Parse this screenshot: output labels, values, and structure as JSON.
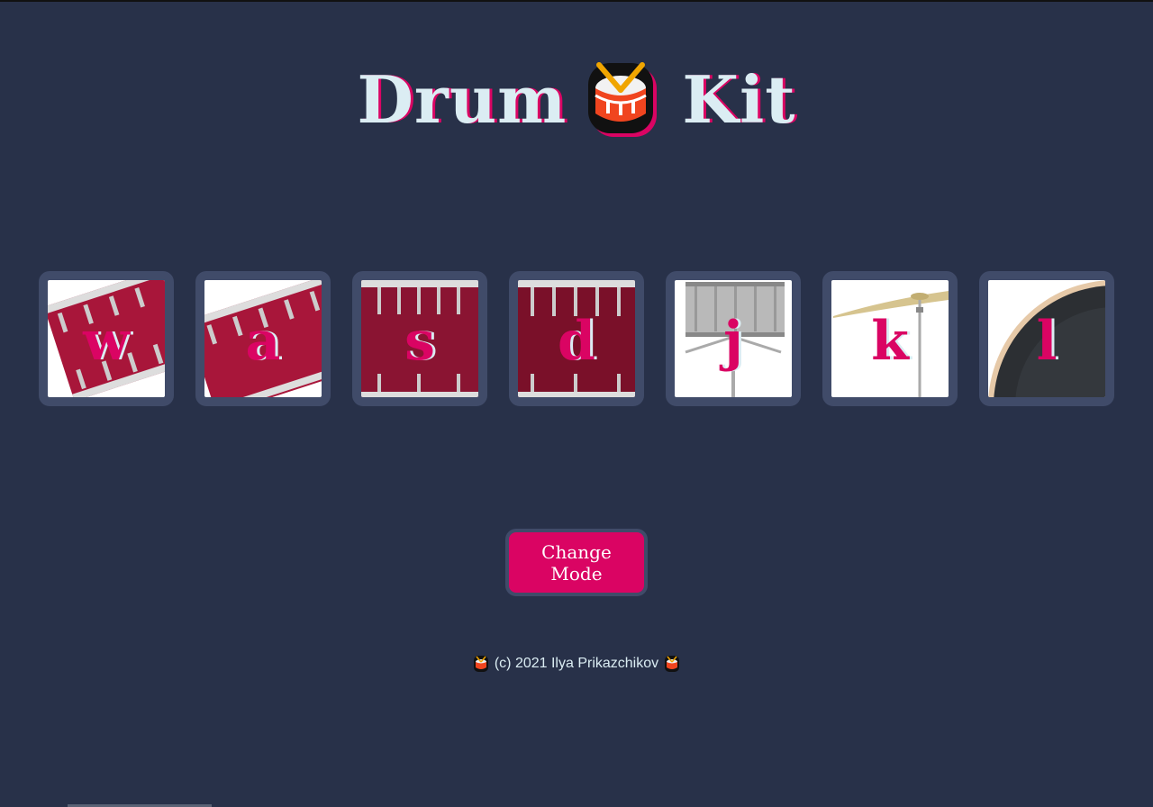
{
  "header": {
    "title_left": "Drum",
    "title_right": "Kit",
    "logo_icon": "drum-icon"
  },
  "pads": [
    {
      "key": "w",
      "drum": "tom-1",
      "color": "#a8163a"
    },
    {
      "key": "a",
      "drum": "tom-2",
      "color": "#a8163a"
    },
    {
      "key": "s",
      "drum": "tom-3",
      "color": "#8a1432"
    },
    {
      "key": "d",
      "drum": "tom-4",
      "color": "#7a1029"
    },
    {
      "key": "j",
      "drum": "snare",
      "color": "#b9b9b9"
    },
    {
      "key": "k",
      "drum": "crash",
      "color": "#d6c48f"
    },
    {
      "key": "l",
      "drum": "kick-bass",
      "color": "#2c2f33"
    }
  ],
  "controls": {
    "change_mode_label": "Change Mode"
  },
  "footer": {
    "text": "(c) 2021 Ilya Prikazchikov"
  },
  "colors": {
    "background": "#283149",
    "pad_border": "#404b69",
    "accent": "#da0463",
    "light": "#dbedf3"
  }
}
